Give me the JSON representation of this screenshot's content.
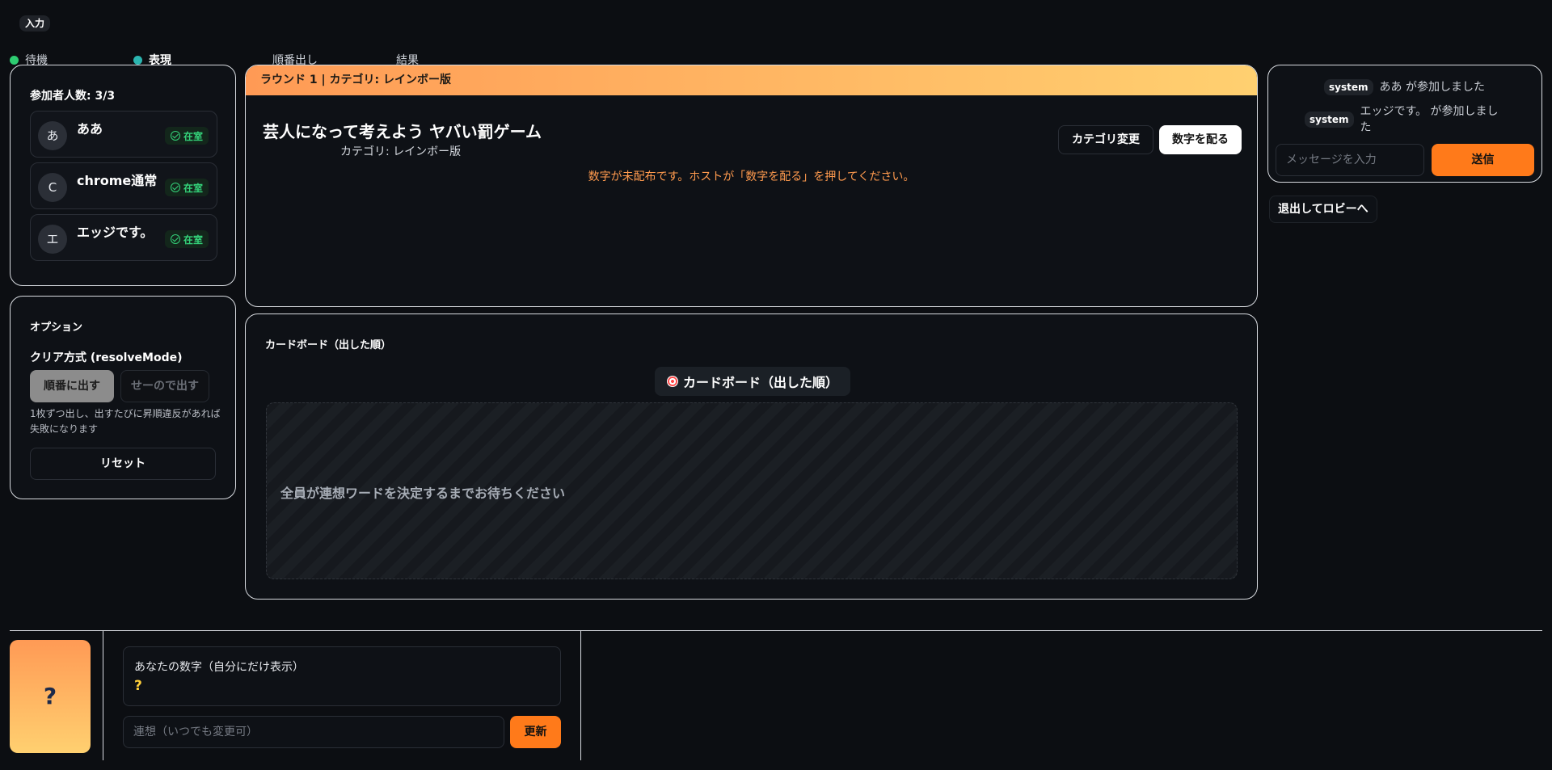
{
  "input_tag": "入力",
  "phases": [
    {
      "label": "待機",
      "dot_color": "#2ecc71"
    },
    {
      "label": "表現",
      "dot_color": "#2bb5b0"
    },
    {
      "label": "順番出し",
      "dot_color": ""
    },
    {
      "label": "結果",
      "dot_color": ""
    }
  ],
  "participants": {
    "title": "参加者人数: 3/3",
    "items": [
      {
        "initial": "あ",
        "name": "ああ",
        "status": "在室"
      },
      {
        "initial": "C",
        "name": "chrome通常",
        "status": "在室"
      },
      {
        "initial": "エ",
        "name": "エッジです。",
        "status": "在室"
      }
    ]
  },
  "options": {
    "title": "オプション",
    "resolve_label": "クリア方式 (resolveMode)",
    "mode_sequential": "順番に出す",
    "mode_simultaneous": "せーので出す",
    "hint": "1枚ずつ出し、出すたびに昇順違反があれば失敗になります",
    "reset_label": "リセット"
  },
  "game": {
    "header": "ラウンド 1 | カテゴリ: レインボー版",
    "title": "芸人になって考えよう ヤバい罰ゲーム",
    "category": "カテゴリ: レインボー版",
    "change_category_label": "カテゴリ変更",
    "deal_label": "数字を配る",
    "message": "数字が未配布です。ホストが「数字を配る」を押してください。"
  },
  "board": {
    "title": "カードボード（出した順）",
    "chip_label": "カードボード（出した順）",
    "waiting": "全員が連想ワードを決定するまでお待ちください"
  },
  "chat": {
    "messages": [
      {
        "sender": "system",
        "text": "ああ が参加しました"
      },
      {
        "sender": "system",
        "text": "エッジです。 が参加しました"
      }
    ],
    "input_placeholder": "メッセージを入力",
    "send_label": "送信"
  },
  "leave_label": "退出してロビーへ",
  "my_card": {
    "symbol": "?"
  },
  "my_number": {
    "label": "あなたの数字（自分にだけ表示）",
    "value": "?"
  },
  "association": {
    "placeholder": "連想（いつでも変更可）",
    "update_label": "更新"
  },
  "colors": {
    "accent": "#ff7a1a",
    "header_gradient_start": "#ff9a55",
    "header_gradient_end": "#ffd070",
    "online": "#34d37a"
  }
}
